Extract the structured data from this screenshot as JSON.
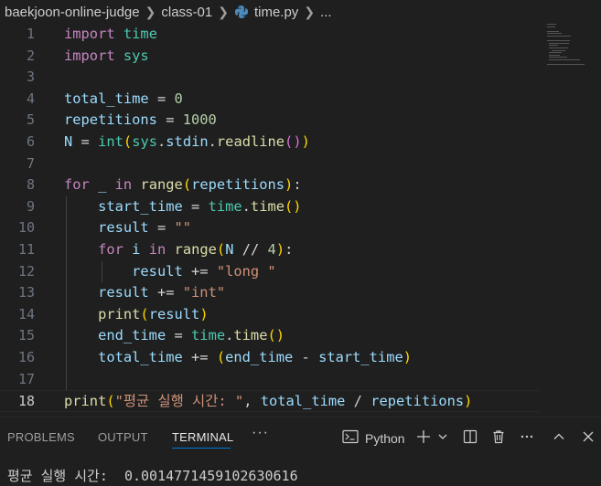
{
  "breadcrumb": {
    "folder": "baekjoon-online-judge",
    "subfolder": "class-01",
    "file": "time.py",
    "more": "..."
  },
  "editor": {
    "line_numbers": [
      "1",
      "2",
      "3",
      "4",
      "5",
      "6",
      "7",
      "8",
      "9",
      "10",
      "11",
      "12",
      "13",
      "14",
      "15",
      "16",
      "17",
      "18"
    ],
    "active_line": "18",
    "lines": [
      [
        [
          "kw",
          "import"
        ],
        [
          "p",
          " "
        ],
        [
          "mod",
          "time"
        ]
      ],
      [
        [
          "kw",
          "import"
        ],
        [
          "p",
          " "
        ],
        [
          "mod",
          "sys"
        ]
      ],
      [],
      [
        [
          "var",
          "total_time"
        ],
        [
          "op",
          " = "
        ],
        [
          "num",
          "0"
        ]
      ],
      [
        [
          "var",
          "repetitions"
        ],
        [
          "op",
          " = "
        ],
        [
          "num",
          "1000"
        ]
      ],
      [
        [
          "var",
          "N"
        ],
        [
          "op",
          " = "
        ],
        [
          "mod",
          "int"
        ],
        [
          "b1",
          "("
        ],
        [
          "mod",
          "sys"
        ],
        [
          "op",
          "."
        ],
        [
          "var",
          "stdin"
        ],
        [
          "op",
          "."
        ],
        [
          "fn",
          "readline"
        ],
        [
          "b2",
          "()"
        ],
        [
          "b1",
          ")"
        ]
      ],
      [],
      [
        [
          "kw",
          "for"
        ],
        [
          "p",
          " "
        ],
        [
          "var",
          "_"
        ],
        [
          "p",
          " "
        ],
        [
          "kw",
          "in"
        ],
        [
          "p",
          " "
        ],
        [
          "fn",
          "range"
        ],
        [
          "b1",
          "("
        ],
        [
          "var",
          "repetitions"
        ],
        [
          "b1",
          ")"
        ],
        [
          "op",
          ":"
        ]
      ],
      [
        [
          "p",
          "    "
        ],
        [
          "var",
          "start_time"
        ],
        [
          "op",
          " = "
        ],
        [
          "mod",
          "time"
        ],
        [
          "op",
          "."
        ],
        [
          "fn",
          "time"
        ],
        [
          "b1",
          "()"
        ]
      ],
      [
        [
          "p",
          "    "
        ],
        [
          "var",
          "result"
        ],
        [
          "op",
          " = "
        ],
        [
          "str",
          "\"\""
        ]
      ],
      [
        [
          "p",
          "    "
        ],
        [
          "kw",
          "for"
        ],
        [
          "p",
          " "
        ],
        [
          "var",
          "i"
        ],
        [
          "p",
          " "
        ],
        [
          "kw",
          "in"
        ],
        [
          "p",
          " "
        ],
        [
          "fn",
          "range"
        ],
        [
          "b1",
          "("
        ],
        [
          "var",
          "N"
        ],
        [
          "op",
          " // "
        ],
        [
          "num",
          "4"
        ],
        [
          "b1",
          ")"
        ],
        [
          "op",
          ":"
        ]
      ],
      [
        [
          "p",
          "        "
        ],
        [
          "var",
          "result"
        ],
        [
          "op",
          " += "
        ],
        [
          "str",
          "\"long \""
        ]
      ],
      [
        [
          "p",
          "    "
        ],
        [
          "var",
          "result"
        ],
        [
          "op",
          " += "
        ],
        [
          "str",
          "\"int\""
        ]
      ],
      [
        [
          "p",
          "    "
        ],
        [
          "fn",
          "print"
        ],
        [
          "b1",
          "("
        ],
        [
          "var",
          "result"
        ],
        [
          "b1",
          ")"
        ]
      ],
      [
        [
          "p",
          "    "
        ],
        [
          "var",
          "end_time"
        ],
        [
          "op",
          " = "
        ],
        [
          "mod",
          "time"
        ],
        [
          "op",
          "."
        ],
        [
          "fn",
          "time"
        ],
        [
          "b1",
          "()"
        ]
      ],
      [
        [
          "p",
          "    "
        ],
        [
          "var",
          "total_time"
        ],
        [
          "op",
          " += "
        ],
        [
          "b1",
          "("
        ],
        [
          "var",
          "end_time"
        ],
        [
          "op",
          " - "
        ],
        [
          "var",
          "start_time"
        ],
        [
          "b1",
          ")"
        ]
      ],
      [],
      [
        [
          "fn",
          "print"
        ],
        [
          "b1",
          "("
        ],
        [
          "str",
          "\"평균 실행 시간: \""
        ],
        [
          "op",
          ", "
        ],
        [
          "var",
          "total_time"
        ],
        [
          "op",
          " / "
        ],
        [
          "var",
          "repetitions"
        ],
        [
          "b1",
          ")"
        ]
      ]
    ]
  },
  "panel": {
    "tabs": [
      "PROBLEMS",
      "OUTPUT",
      "TERMINAL"
    ],
    "active_tab": "TERMINAL",
    "more": "···",
    "terminal_profile": "Python",
    "icons": [
      "terminal-icon",
      "add-icon",
      "chevron-down-icon",
      "split-icon",
      "trash-icon",
      "more-icon",
      "chevron-up-icon",
      "close-icon"
    ]
  },
  "terminal": {
    "output": "평균 실행 시간:  0.0014771459102630616"
  },
  "colors": {
    "background": "#1f1f1f",
    "keyword": "#c586c0",
    "module": "#4ec9b0",
    "variable": "#9cdcfe",
    "function": "#dcdcaa",
    "number": "#b5cea8",
    "string": "#ce9178",
    "accent": "#0078d4"
  }
}
